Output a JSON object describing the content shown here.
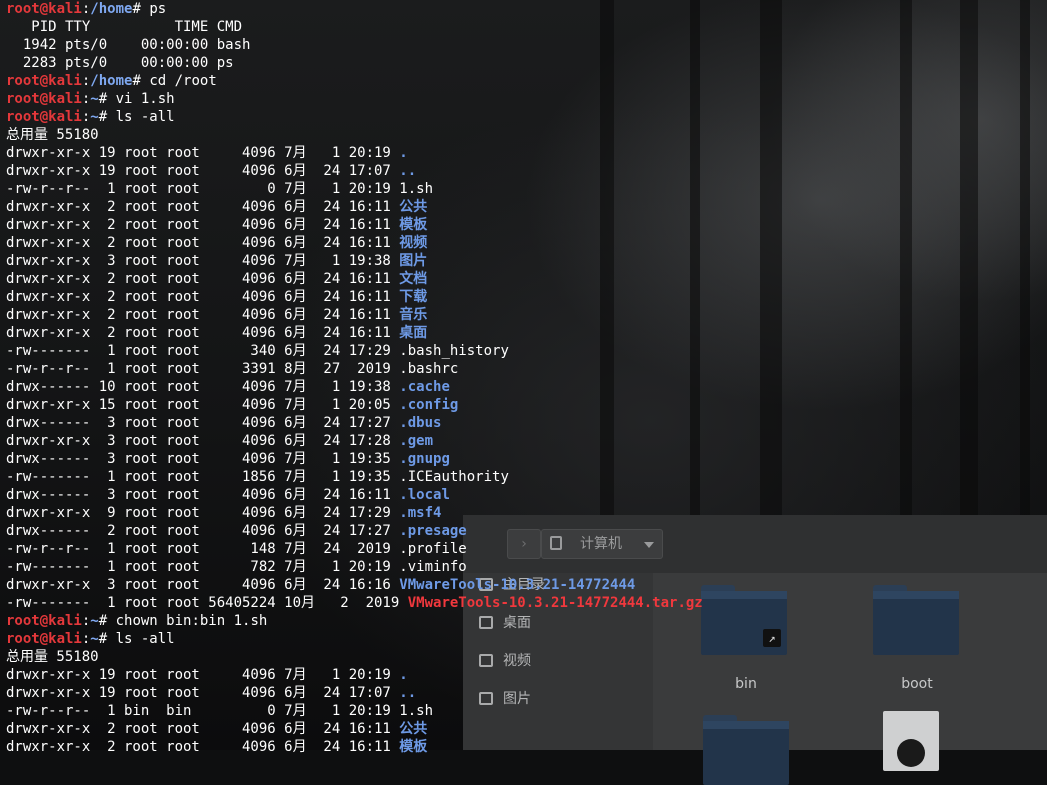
{
  "terminal": {
    "prompt_user": "root@kali",
    "lines": [
      {
        "type": "prompt",
        "dir": "/home",
        "cmd": "ps"
      },
      {
        "type": "text",
        "text": "   PID TTY          TIME CMD"
      },
      {
        "type": "text",
        "text": "  1942 pts/0    00:00:00 bash"
      },
      {
        "type": "text",
        "text": "  2283 pts/0    00:00:00 ps"
      },
      {
        "type": "prompt",
        "dir": "/home",
        "cmd": "cd /root"
      },
      {
        "type": "prompt",
        "dir": "~",
        "cmd": "vi 1.sh"
      },
      {
        "type": "prompt",
        "dir": "~",
        "cmd": "ls -all"
      },
      {
        "type": "text",
        "text": "总用量 55180"
      },
      {
        "type": "ls",
        "meta": "drwxr-xr-x 19 root root     4096 7月   1 20:19 ",
        "name": ".",
        "style": "dir"
      },
      {
        "type": "ls",
        "meta": "drwxr-xr-x 19 root root     4096 6月  24 17:07 ",
        "name": "..",
        "style": "dir"
      },
      {
        "type": "ls",
        "meta": "-rw-r--r--  1 root root        0 7月   1 20:19 ",
        "name": "1.sh",
        "style": "plain"
      },
      {
        "type": "ls",
        "meta": "drwxr-xr-x  2 root root     4096 6月  24 16:11 ",
        "name": "公共",
        "style": "dir"
      },
      {
        "type": "ls",
        "meta": "drwxr-xr-x  2 root root     4096 6月  24 16:11 ",
        "name": "模板",
        "style": "dir"
      },
      {
        "type": "ls",
        "meta": "drwxr-xr-x  2 root root     4096 6月  24 16:11 ",
        "name": "视频",
        "style": "dir"
      },
      {
        "type": "ls",
        "meta": "drwxr-xr-x  3 root root     4096 7月   1 19:38 ",
        "name": "图片",
        "style": "dir"
      },
      {
        "type": "ls",
        "meta": "drwxr-xr-x  2 root root     4096 6月  24 16:11 ",
        "name": "文档",
        "style": "dir"
      },
      {
        "type": "ls",
        "meta": "drwxr-xr-x  2 root root     4096 6月  24 16:11 ",
        "name": "下载",
        "style": "dir"
      },
      {
        "type": "ls",
        "meta": "drwxr-xr-x  2 root root     4096 6月  24 16:11 ",
        "name": "音乐",
        "style": "dir"
      },
      {
        "type": "ls",
        "meta": "drwxr-xr-x  2 root root     4096 6月  24 16:11 ",
        "name": "桌面",
        "style": "dir"
      },
      {
        "type": "ls",
        "meta": "-rw-------  1 root root      340 6月  24 17:29 ",
        "name": ".bash_history",
        "style": "plain"
      },
      {
        "type": "ls",
        "meta": "-rw-r--r--  1 root root     3391 8月  27  2019 ",
        "name": ".bashrc",
        "style": "plain"
      },
      {
        "type": "ls",
        "meta": "drwx------ 10 root root     4096 7月   1 19:38 ",
        "name": ".cache",
        "style": "dir"
      },
      {
        "type": "ls",
        "meta": "drwxr-xr-x 15 root root     4096 7月   1 20:05 ",
        "name": ".config",
        "style": "dir"
      },
      {
        "type": "ls",
        "meta": "drwx------  3 root root     4096 6月  24 17:27 ",
        "name": ".dbus",
        "style": "dir"
      },
      {
        "type": "ls",
        "meta": "drwxr-xr-x  3 root root     4096 6月  24 17:28 ",
        "name": ".gem",
        "style": "dir"
      },
      {
        "type": "ls",
        "meta": "drwx------  3 root root     4096 7月   1 19:35 ",
        "name": ".gnupg",
        "style": "dir"
      },
      {
        "type": "ls",
        "meta": "-rw-------  1 root root     1856 7月   1 19:35 ",
        "name": ".ICEauthority",
        "style": "plain"
      },
      {
        "type": "ls",
        "meta": "drwx------  3 root root     4096 6月  24 16:11 ",
        "name": ".local",
        "style": "dir"
      },
      {
        "type": "ls",
        "meta": "drwxr-xr-x  9 root root     4096 6月  24 17:29 ",
        "name": ".msf4",
        "style": "dir"
      },
      {
        "type": "ls",
        "meta": "drwx------  2 root root     4096 6月  24 17:27 ",
        "name": ".presage",
        "style": "dir"
      },
      {
        "type": "ls",
        "meta": "-rw-r--r--  1 root root      148 7月  24  2019 ",
        "name": ".profile",
        "style": "plain"
      },
      {
        "type": "ls",
        "meta": "-rw-------  1 root root      782 7月   1 20:19 ",
        "name": ".viminfo",
        "style": "plain"
      },
      {
        "type": "ls",
        "meta": "drwxr-xr-x  3 root root     4096 6月  24 16:16 ",
        "name": "VMwareTools-10.3.21-14772444",
        "style": "dir"
      },
      {
        "type": "ls",
        "meta": "-rw-------  1 root root 56405224 10月   2  2019 ",
        "name": "VMwareTools-10.3.21-14772444.tar.gz",
        "style": "arc"
      },
      {
        "type": "prompt",
        "dir": "~",
        "cmd": "chown bin:bin 1.sh"
      },
      {
        "type": "prompt",
        "dir": "~",
        "cmd": "ls -all"
      },
      {
        "type": "text",
        "text": "总用量 55180"
      },
      {
        "type": "ls",
        "meta": "drwxr-xr-x 19 root root     4096 7月   1 20:19 ",
        "name": ".",
        "style": "dir"
      },
      {
        "type": "ls",
        "meta": "drwxr-xr-x 19 root root     4096 6月  24 17:07 ",
        "name": "..",
        "style": "dir"
      },
      {
        "type": "ls",
        "meta": "-rw-r--r--  1 bin  bin         0 7月   1 20:19 ",
        "name": "1.sh",
        "style": "plain"
      },
      {
        "type": "ls",
        "meta": "drwxr-xr-x  2 root root     4096 6月  24 16:11 ",
        "name": "公共",
        "style": "dir"
      },
      {
        "type": "ls",
        "meta": "drwxr-xr-x  2 root root     4096 6月  24 16:11 ",
        "name": "模板",
        "style": "dir"
      }
    ]
  },
  "file_manager": {
    "back_icon": "chevron-right-icon",
    "location": "计算机",
    "sidebar": [
      {
        "label": "主目录",
        "icon": "home-icon"
      },
      {
        "label": "桌面",
        "icon": "desktop-icon"
      },
      {
        "label": "视频",
        "icon": "video-icon"
      },
      {
        "label": "图片",
        "icon": "image-icon"
      }
    ],
    "items": [
      {
        "label": "bin"
      },
      {
        "label": "boot"
      }
    ]
  }
}
